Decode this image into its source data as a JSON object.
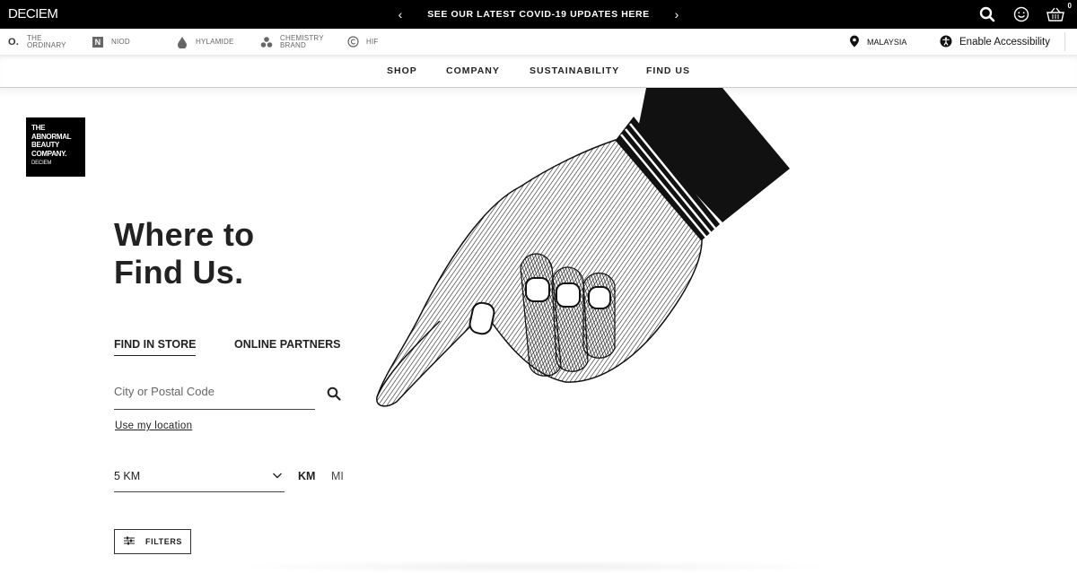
{
  "topbar": {
    "brand": "DECIEM",
    "promo_text": "SEE OUR LATEST COVID-19 UPDATES HERE",
    "prev_icon": "chevron-left-icon",
    "next_icon": "chevron-right-icon",
    "cart_count": "0",
    "icons": [
      "search-icon",
      "smiley-icon",
      "basket-icon"
    ]
  },
  "brandbar": {
    "brands": [
      {
        "line1": "THE",
        "line2": "ORDINARY",
        "icon": "ordinary-logo-icon"
      },
      {
        "line1": "NIOD",
        "line2": "",
        "icon": "niod-logo-icon"
      },
      {
        "line1": "HYLAMIDE",
        "line2": "",
        "icon": "drop-icon"
      },
      {
        "line1": "CHEMISTRY",
        "line2": "BRAND",
        "icon": "molecule-icon"
      },
      {
        "line1": "HIF",
        "line2": "",
        "icon": "copyright-icon"
      }
    ],
    "region": "MALAYSIA",
    "accessibility": "Enable Accessibility"
  },
  "nav": {
    "items": [
      "SHOP",
      "COMPANY",
      "SUSTAINABILITY",
      "FIND US"
    ]
  },
  "logo": {
    "line1": "THE",
    "line2": "ABNORMAL",
    "line3": "BEAUTY",
    "line4": "COMPANY.",
    "line5": "DECIEM"
  },
  "main": {
    "heading_line1": "Where to",
    "heading_line2": "Find Us.",
    "tabs": [
      {
        "label": "FIND IN STORE",
        "active": true
      },
      {
        "label": "ONLINE PARTNERS",
        "active": false
      }
    ],
    "search_placeholder": "City or Postal Code",
    "use_location": "Use my location",
    "radius_value": "5 KM",
    "unit_km": "KM",
    "unit_mi": "MI",
    "filters_label": "FILTERS"
  },
  "colors": {
    "topbar_bg": "#000000",
    "text": "#222222"
  }
}
